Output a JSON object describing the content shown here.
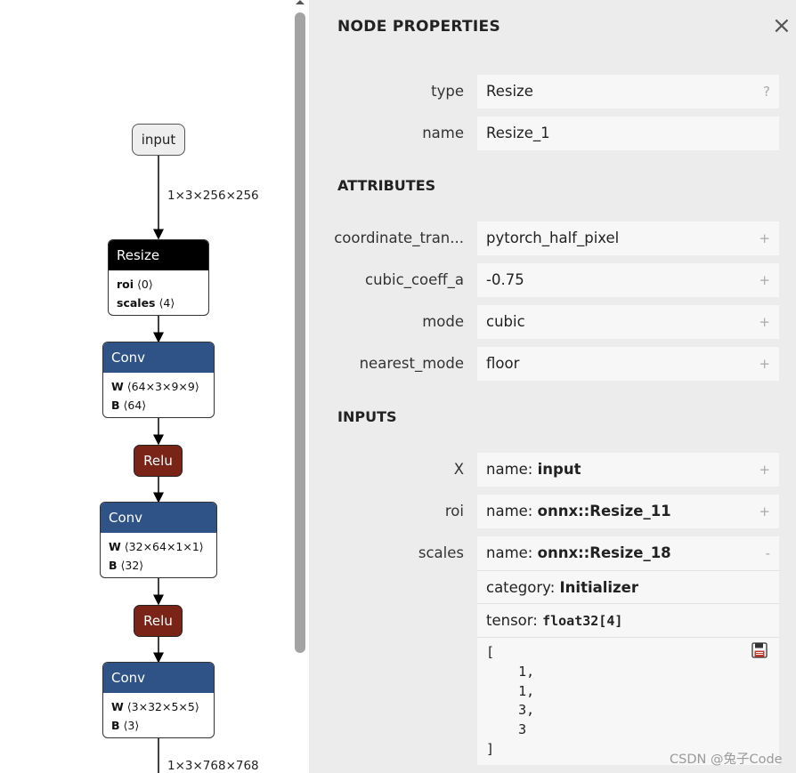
{
  "graph": {
    "input_node": "input",
    "edges": {
      "input_shape": "1×3×256×256",
      "output_shape": "1×3×768×768"
    },
    "nodes": [
      {
        "op": "Resize",
        "color": "#000000",
        "params": [
          {
            "name": "roi",
            "value": "⟨0⟩"
          },
          {
            "name": "scales",
            "value": "⟨4⟩"
          }
        ]
      },
      {
        "op": "Conv",
        "color": "#2f5287",
        "params": [
          {
            "name": "W",
            "value": "⟨64×3×9×9⟩"
          },
          {
            "name": "B",
            "value": "⟨64⟩"
          }
        ]
      },
      {
        "op": "Relu",
        "color": "#7a2418"
      },
      {
        "op": "Conv",
        "color": "#2f5287",
        "params": [
          {
            "name": "W",
            "value": "⟨32×64×1×1⟩"
          },
          {
            "name": "B",
            "value": "⟨32⟩"
          }
        ]
      },
      {
        "op": "Relu",
        "color": "#7a2418"
      },
      {
        "op": "Conv",
        "color": "#2f5287",
        "params": [
          {
            "name": "W",
            "value": "⟨3×32×5×5⟩"
          },
          {
            "name": "B",
            "value": "⟨3⟩"
          }
        ]
      }
    ]
  },
  "panel": {
    "title": "NODE PROPERTIES",
    "close_icon": "×",
    "type": {
      "label": "type",
      "value": "Resize",
      "button": "?"
    },
    "name": {
      "label": "name",
      "value": "Resize_1"
    },
    "attributes_heading": "ATTRIBUTES",
    "attributes": [
      {
        "label": "coordinate_tran...",
        "value": "pytorch_half_pixel",
        "button": "+"
      },
      {
        "label": "cubic_coeff_a",
        "value": "-0.75",
        "button": "+"
      },
      {
        "label": "mode",
        "value": "cubic",
        "button": "+"
      },
      {
        "label": "nearest_mode",
        "value": "floor",
        "button": "+"
      }
    ],
    "inputs_heading": "INPUTS",
    "inputs": [
      {
        "label": "X",
        "prefix": "name: ",
        "value": "input",
        "button": "+"
      },
      {
        "label": "roi",
        "prefix": "name: ",
        "value": "onnx::Resize_11",
        "button": "+"
      },
      {
        "label": "scales",
        "prefix": "name: ",
        "value": "onnx::Resize_18",
        "button": "-"
      }
    ],
    "scales_details": {
      "category_prefix": "category: ",
      "category": "Initializer",
      "tensor_prefix": "tensor: ",
      "tensor": "float32[4]",
      "values_text": "[\n    1,\n    1,\n    3,\n    3\n]"
    },
    "save_icon": "save-icon"
  },
  "watermark": "CSDN @兔子Code"
}
